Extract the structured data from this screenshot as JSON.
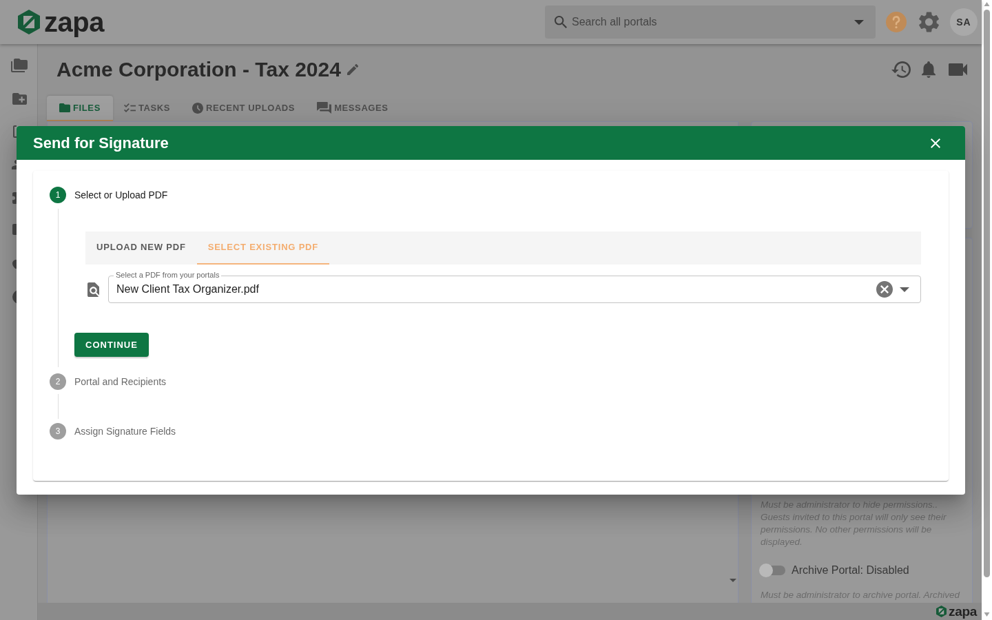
{
  "app_bar": {
    "logo_text": "zapa",
    "search": {
      "placeholder": "Search all portals"
    },
    "avatar_initials": "SA"
  },
  "portal": {
    "title": "Acme Corporation - Tax 2024",
    "tabs": [
      {
        "label": "FILES",
        "selected": true
      },
      {
        "label": "TASKS",
        "selected": false
      },
      {
        "label": "RECENT UPLOADS",
        "selected": false
      },
      {
        "label": "MESSAGES",
        "selected": false
      }
    ],
    "settings_panel": [
      {
        "kind": "note",
        "text": "Must be administrator to hide permissions.. Guests invited to this portal will only see their permissions. No other permissions will be displayed."
      },
      {
        "kind": "toggle",
        "label": "Archive Portal: Disabled",
        "on": false
      },
      {
        "kind": "note",
        "text": "Must be administrator to archive portal. Archived"
      }
    ]
  },
  "dialog": {
    "title": "Send for Signature",
    "steps": [
      {
        "number": "1",
        "label": "Select or Upload PDF",
        "active": true
      },
      {
        "number": "2",
        "label": "Portal and Recipients",
        "active": false
      },
      {
        "number": "3",
        "label": "Assign Signature Fields",
        "active": false
      }
    ],
    "source_tabs": [
      {
        "label": "UPLOAD NEW PDF",
        "selected": false
      },
      {
        "label": "SELECT EXISTING PDF",
        "selected": true
      }
    ],
    "pdf_field": {
      "label": "Select a PDF from your portals",
      "value": "New Client Tax Organizer.pdf"
    },
    "continue_button": "CONTINUE"
  },
  "footer": {
    "logo_text": "zapa"
  }
}
